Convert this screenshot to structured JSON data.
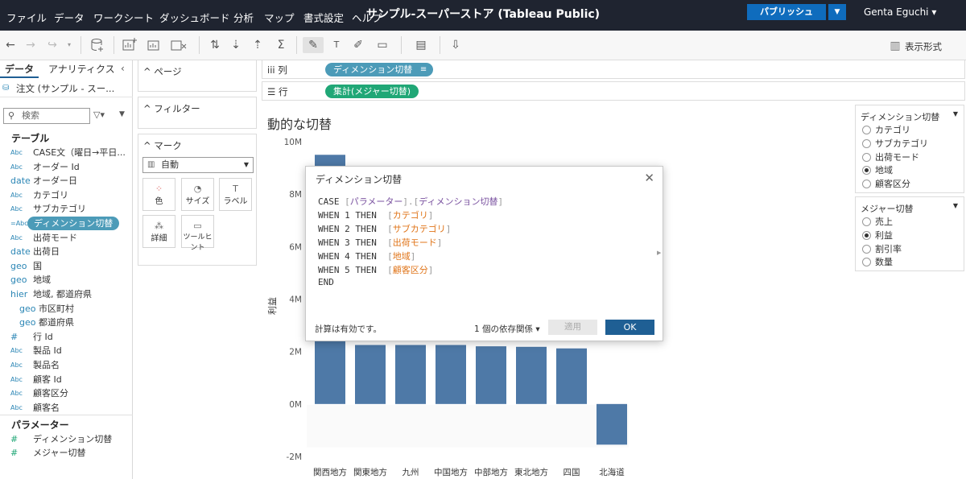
{
  "menubar": {
    "items": [
      "ファイル",
      "データ",
      "ワークシート",
      "ダッシュボード",
      "分析",
      "マップ",
      "書式設定",
      "ヘルプ"
    ],
    "title": "サンプル-スーパーストア (Tableau Public)",
    "publish_label": "パブリッシュ",
    "user": "Genta Eguchi ▾"
  },
  "toolbar": {
    "show_me_label": "表示形式"
  },
  "datapane": {
    "tab_data": "データ",
    "tab_analytics": "アナリティクス",
    "datasource": "注文 (サンプル - スー...",
    "search_placeholder": "検索",
    "tables_header": "テーブル",
    "fields": [
      {
        "type": "Abc",
        "name": "CASE文（曜日→平日..."
      },
      {
        "type": "Abc",
        "name": "オーダー Id"
      },
      {
        "type": "date",
        "name": "オーダー日"
      },
      {
        "type": "Abc",
        "name": "カテゴリ"
      },
      {
        "type": "Abc",
        "name": "サブカテゴリ"
      },
      {
        "type": "=Abc",
        "name": "ディメンション切替"
      },
      {
        "type": "Abc",
        "name": "出荷モード"
      },
      {
        "type": "date",
        "name": "出荷日"
      },
      {
        "type": "geo",
        "name": "国"
      },
      {
        "type": "geo",
        "name": "地域"
      },
      {
        "type": "hier",
        "name": "地域, 都道府県"
      },
      {
        "type": "geo",
        "name": "市区町村"
      },
      {
        "type": "geo",
        "name": "都道府県"
      },
      {
        "type": "#",
        "name": "行 Id"
      },
      {
        "type": "Abc",
        "name": "製品 Id"
      },
      {
        "type": "Abc",
        "name": "製品名"
      },
      {
        "type": "Abc",
        "name": "顧客 Id"
      },
      {
        "type": "Abc",
        "name": "顧客区分"
      },
      {
        "type": "Abc",
        "name": "顧客名"
      }
    ],
    "params_header": "パラメーター",
    "params": [
      "ディメンション切替",
      "メジャー切替"
    ]
  },
  "cards": {
    "pages": "ページ",
    "filters": "フィルター",
    "marks": "マーク",
    "mark_type": "自動",
    "mark_buttons": [
      "色",
      "サイズ",
      "ラベル",
      "詳細",
      "ツールヒント"
    ]
  },
  "shelves": {
    "columns_label": "列",
    "columns_pill": "ディメンション切替",
    "rows_label": "行",
    "rows_pill": "集計(メジャー切替)"
  },
  "view": {
    "title": "動的な切替"
  },
  "legend_dimension": {
    "title": "ディメンション切替",
    "options": [
      "カテゴリ",
      "サブカテゴリ",
      "出荷モード",
      "地域",
      "顧客区分"
    ],
    "selected": "地域"
  },
  "legend_measure": {
    "title": "メジャー切替",
    "options": [
      "売上",
      "利益",
      "割引率",
      "数量"
    ],
    "selected": "利益"
  },
  "dialog": {
    "title": "ディメンション切替",
    "code": {
      "case_kw": "CASE",
      "case_param": "パラメーター",
      "case_dim": "ディメンション切替",
      "when": [
        {
          "n": "1",
          "field": "カテゴリ"
        },
        {
          "n": "2",
          "field": "サブカテゴリ"
        },
        {
          "n": "3",
          "field": "出荷モード"
        },
        {
          "n": "4",
          "field": "地域"
        },
        {
          "n": "5",
          "field": "顧客区分"
        }
      ],
      "when_kw": "WHEN",
      "then_kw": "THEN",
      "end_kw": "END"
    },
    "status": "計算は有効です。",
    "deps": "1 個の依存関係 ▾",
    "apply": "適用",
    "ok": "OK"
  },
  "colors": {
    "menubar": "#1f2430",
    "bar": "#4e79a7",
    "pill_dimension": "#4c9bb8",
    "pill_measure": "#20a776",
    "publish": "#0f6cbd",
    "ok": "#1f5f94"
  },
  "chart_data": {
    "type": "bar",
    "title": "動的な切替",
    "ylabel": "利益",
    "categories": [
      "関西地方",
      "関東地方",
      "九州",
      "中国地方",
      "中部地方",
      "東北地方",
      "四国",
      "北海道"
    ],
    "values": [
      9500000,
      2250000,
      2250000,
      2250000,
      2200000,
      2180000,
      2120000,
      -1550000
    ],
    "ylim": [
      -2000000,
      10000000
    ],
    "yticks": [
      -2000000,
      0,
      2000000,
      4000000,
      6000000,
      8000000,
      10000000
    ],
    "ytick_labels": [
      "-2M",
      "0M",
      "2M",
      "4M",
      "6M",
      "8M",
      "10M"
    ],
    "grid": false,
    "legend": "none"
  }
}
